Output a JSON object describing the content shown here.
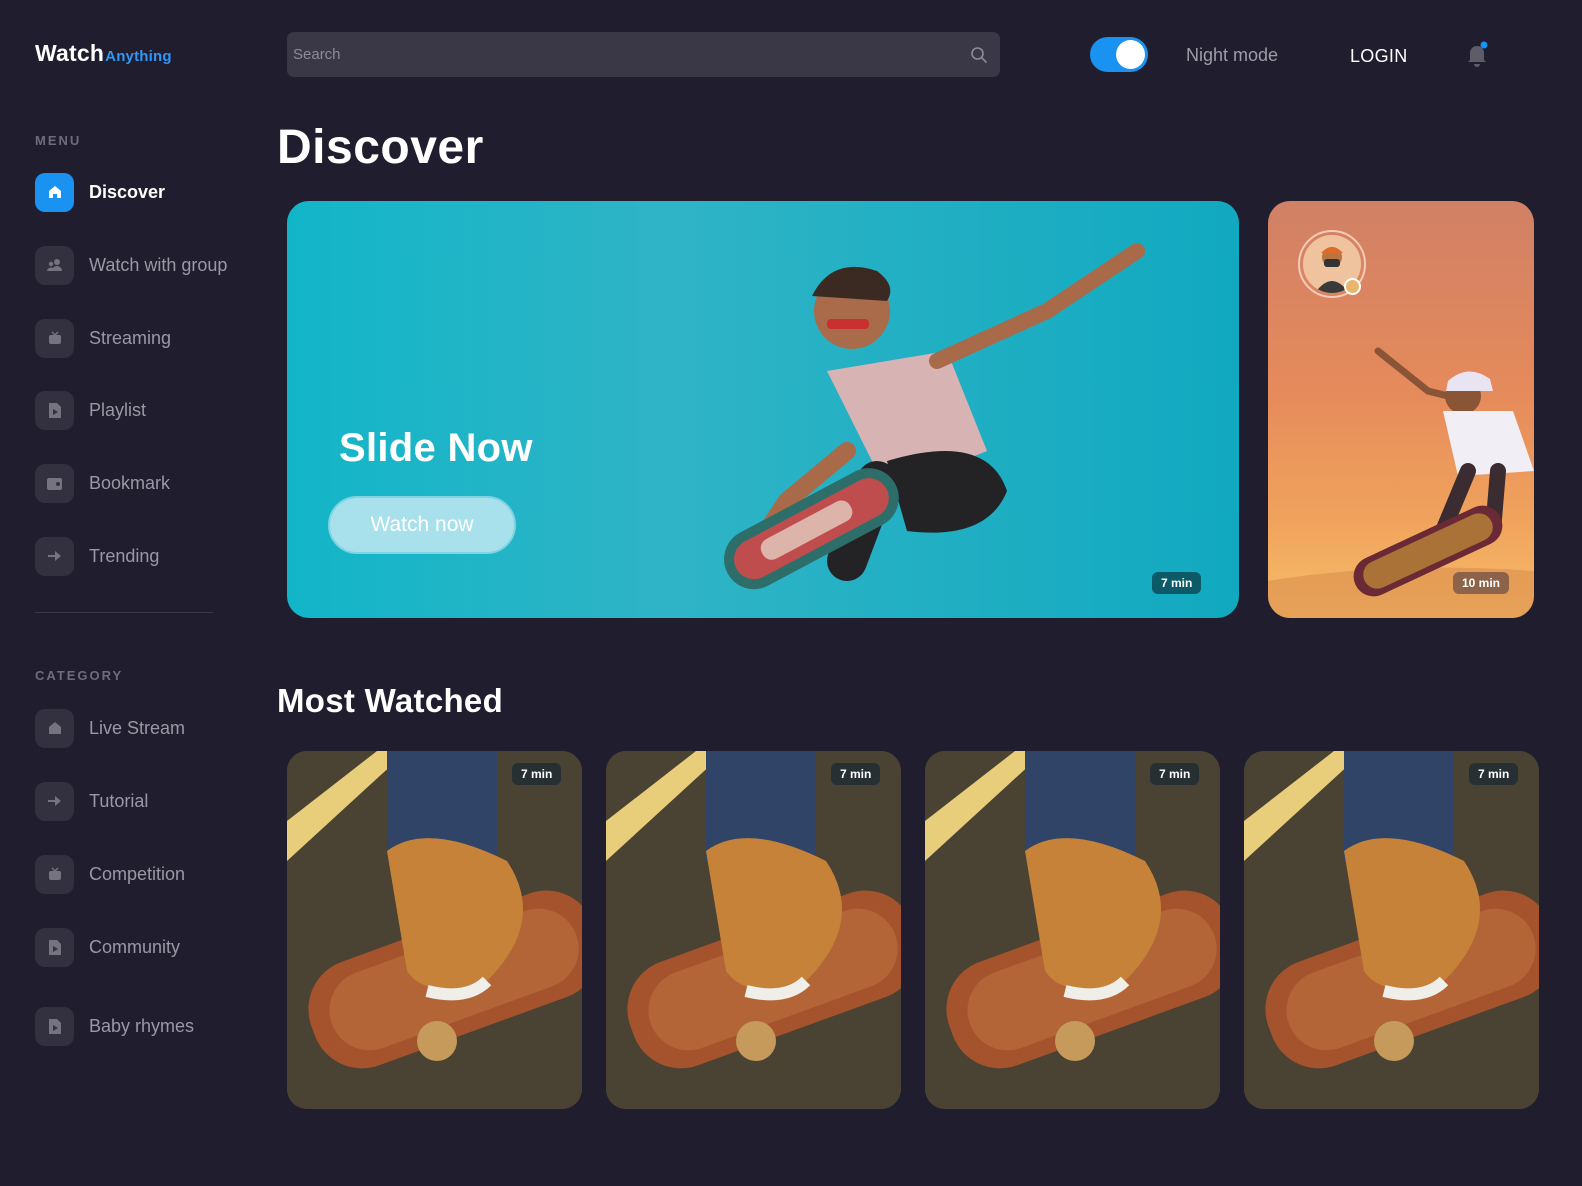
{
  "brand": {
    "name": "Watch",
    "suffix": "Anything"
  },
  "search": {
    "placeholder": "Search"
  },
  "header": {
    "night_mode_label": "Night mode",
    "night_mode_on": true,
    "login_label": "LOGIN"
  },
  "menu": {
    "title": "MENU",
    "items": [
      {
        "label": "Discover",
        "icon": "home-icon",
        "active": true
      },
      {
        "label": "Watch with group",
        "icon": "group-icon",
        "active": false
      },
      {
        "label": "Streaming",
        "icon": "tv-icon",
        "active": false
      },
      {
        "label": "Playlist",
        "icon": "playlist-icon",
        "active": false
      },
      {
        "label": "Bookmark",
        "icon": "bookmark-icon",
        "active": false
      },
      {
        "label": "Trending",
        "icon": "trending-icon",
        "active": false
      }
    ]
  },
  "category": {
    "title": "CATEGORY",
    "items": [
      {
        "label": "Live Stream",
        "icon": "home-icon"
      },
      {
        "label": "Tutorial",
        "icon": "arrow-icon"
      },
      {
        "label": "Competition",
        "icon": "tv-icon"
      },
      {
        "label": "Community",
        "icon": "playlist-icon"
      },
      {
        "label": "Baby rhymes",
        "icon": "playlist-icon"
      }
    ]
  },
  "discover": {
    "title": "Discover",
    "hero": {
      "title": "Slide Now",
      "button_label": "Watch now",
      "duration": "7 min"
    },
    "side": {
      "duration": "10 min"
    }
  },
  "most_watched": {
    "title": "Most Watched",
    "cards": [
      {
        "duration": "7 min"
      },
      {
        "duration": "7 min"
      },
      {
        "duration": "7 min"
      },
      {
        "duration": "7 min"
      }
    ]
  },
  "colors": {
    "background": "#201e2e",
    "accent": "#1a92f2",
    "hero": "#12b5c8"
  }
}
